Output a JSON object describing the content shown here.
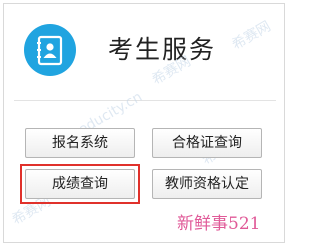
{
  "service": {
    "title": "考生服务",
    "icon": "contact-book-icon"
  },
  "buttons": {
    "registration": "报名系统",
    "certificate_query": "合格证查询",
    "score_query": "成绩查询",
    "teacher_certification": "教师资格认定"
  },
  "watermark": {
    "text": "www.educity.cn",
    "brand": "希赛网"
  },
  "caption": "新鲜事521",
  "colors": {
    "accent": "#20a4e0",
    "highlight": "#e0312b",
    "caption": "#e05a98"
  }
}
